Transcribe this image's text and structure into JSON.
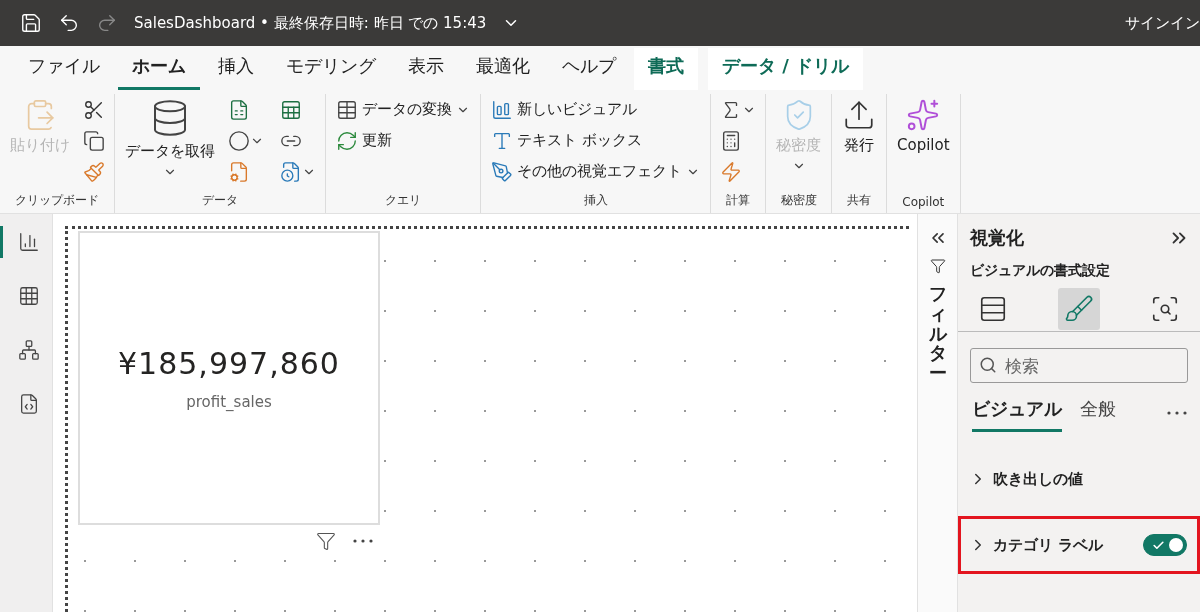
{
  "title_bar": {
    "title": "SalesDashboard • 最終保存日時: 昨日 での 15:43",
    "sign_in": "サインイン"
  },
  "menu_tabs": [
    {
      "label": "ファイル",
      "selected": false,
      "kind": "normal"
    },
    {
      "label": "ホーム",
      "selected": true,
      "kind": "normal"
    },
    {
      "label": "挿入",
      "selected": false,
      "kind": "normal"
    },
    {
      "label": "モデリング",
      "selected": false,
      "kind": "normal"
    },
    {
      "label": "表示",
      "selected": false,
      "kind": "normal"
    },
    {
      "label": "最適化",
      "selected": false,
      "kind": "normal"
    },
    {
      "label": "ヘルプ",
      "selected": false,
      "kind": "normal"
    },
    {
      "label": "書式",
      "selected": false,
      "kind": "contextual"
    },
    {
      "label": "データ / ドリル",
      "selected": false,
      "kind": "contextual"
    }
  ],
  "ribbon_groups": [
    {
      "label": "クリップボード",
      "buttons": [
        {
          "kind": "large",
          "label": "貼り付け",
          "disabled": true,
          "dropdown": false
        },
        {
          "kind": "icon",
          "disabled": false,
          "dropdown": false
        },
        {
          "kind": "icon",
          "disabled": false,
          "dropdown": false
        },
        {
          "kind": "icon",
          "disabled": false,
          "dropdown": false
        }
      ]
    },
    {
      "label": "データ",
      "buttons": [
        {
          "kind": "large",
          "label": "データを取得",
          "disabled": false,
          "dropdown": true
        },
        {
          "kind": "icon",
          "disabled": false,
          "dropdown": false
        },
        {
          "kind": "icon",
          "disabled": false,
          "dropdown": false
        },
        {
          "kind": "icon",
          "disabled": false,
          "dropdown": true
        },
        {
          "kind": "icon",
          "disabled": false,
          "dropdown": false
        },
        {
          "kind": "icon",
          "disabled": false,
          "dropdown": false
        },
        {
          "kind": "icon",
          "disabled": false,
          "dropdown": true
        }
      ]
    },
    {
      "label": "クエリ",
      "buttons": [
        {
          "kind": "small",
          "label": "データの変換",
          "disabled": false,
          "dropdown": true
        },
        {
          "kind": "small",
          "label": "更新",
          "disabled": false,
          "dropdown": false
        }
      ]
    },
    {
      "label": "挿入",
      "buttons": [
        {
          "kind": "small",
          "label": "新しいビジュアル",
          "disabled": false,
          "dropdown": false
        },
        {
          "kind": "small",
          "label": "テキスト ボックス",
          "disabled": false,
          "dropdown": false
        },
        {
          "kind": "small",
          "label": "その他の視覚エフェクト",
          "disabled": false,
          "dropdown": true
        }
      ]
    },
    {
      "label": "計算",
      "buttons": [
        {
          "kind": "icon",
          "disabled": false,
          "dropdown": true
        },
        {
          "kind": "icon",
          "disabled": false,
          "dropdown": false
        },
        {
          "kind": "icon",
          "disabled": false,
          "dropdown": false
        }
      ]
    },
    {
      "label": "秘密度",
      "buttons": [
        {
          "kind": "large",
          "label": "秘密度",
          "disabled": true,
          "dropdown": true
        }
      ]
    },
    {
      "label": "共有",
      "buttons": [
        {
          "kind": "large",
          "label": "発行",
          "disabled": false,
          "dropdown": false
        }
      ]
    },
    {
      "label": "Copilot",
      "buttons": [
        {
          "kind": "large",
          "label": "Copilot",
          "disabled": false,
          "dropdown": false
        }
      ]
    }
  ],
  "left_nav": [
    {
      "selected": true
    },
    {
      "selected": false
    },
    {
      "selected": false
    },
    {
      "selected": false
    }
  ],
  "card_visual": {
    "value": "¥185,997,860",
    "label": "profit_sales"
  },
  "filters_pane": {
    "label": "フィルター"
  },
  "visualizations_pane": {
    "title": "視覚化",
    "subtitle": "ビジュアルの書式設定",
    "modes": [
      {
        "selected": false
      },
      {
        "selected": true
      },
      {
        "selected": false
      }
    ],
    "search": {
      "placeholder": "検索"
    },
    "tabs": [
      {
        "label": "ビジュアル",
        "selected": true
      },
      {
        "label": "全般",
        "selected": false
      }
    ],
    "sections": [
      {
        "label": "吹き出しの値",
        "expanded": false,
        "kind": "plain",
        "highlighted": false
      },
      {
        "label": "カテゴリ ラベル",
        "expanded": false,
        "kind": "toggle",
        "on": true,
        "highlighted": true
      }
    ]
  }
}
